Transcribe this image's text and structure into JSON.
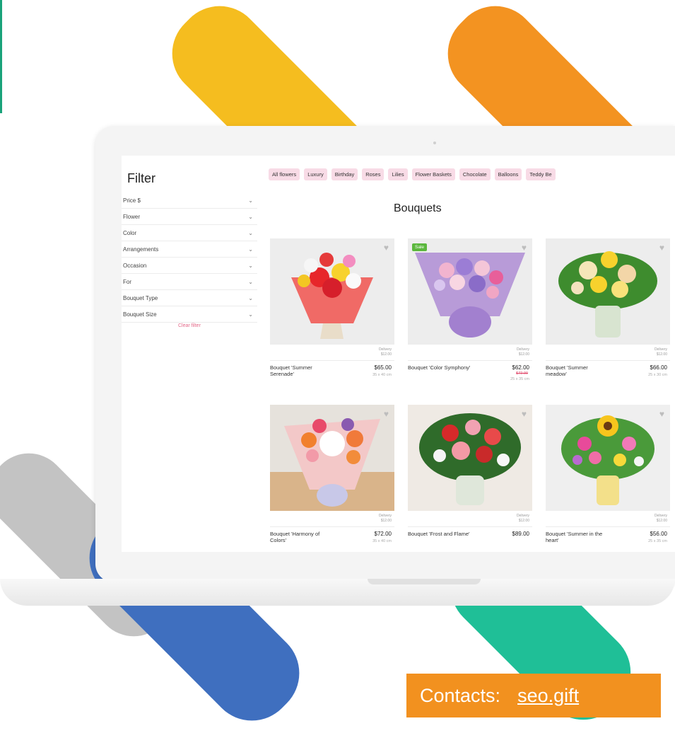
{
  "sidebar": {
    "title": "Filter",
    "filters": [
      "Price $",
      "Flower",
      "Color",
      "Arrangements",
      "Occasion",
      "For",
      "Bouquet Type",
      "Bouquet Size"
    ],
    "clear_label": "Clear filter"
  },
  "tags": [
    "All flowers",
    "Luxury",
    "Birthday",
    "Roses",
    "Lilies",
    "Flower Baskets",
    "Chocolate",
    "Balloons",
    "Teddy Be"
  ],
  "heading": "Bouquets",
  "products": [
    {
      "name": "Bouquet 'Summer Serenade'",
      "price": "$65.00",
      "old_price": "",
      "size": "35 x 40 cm",
      "badge": "",
      "delivery": "Delivery",
      "delivery_price": "$12.00"
    },
    {
      "name": "Bouquet 'Color Symphony'",
      "price": "$62.00",
      "old_price": "$72.00",
      "size": "25 x 35 cm",
      "badge": "Sale",
      "delivery": "Delivery",
      "delivery_price": "$12.00"
    },
    {
      "name": "Bouquet 'Summer meadow'",
      "price": "$66.00",
      "old_price": "",
      "size": "25 x 30 cm",
      "badge": "",
      "delivery": "Delivery",
      "delivery_price": "$12.00"
    },
    {
      "name": "Bouquet 'Harmony of Colors'",
      "price": "$72.00",
      "old_price": "",
      "size": "35 x 40 cm",
      "badge": "",
      "delivery": "Delivery",
      "delivery_price": "$12.00"
    },
    {
      "name": "Bouquet 'Frost and Flame'",
      "price": "$89.00",
      "old_price": "",
      "size": "",
      "badge": "",
      "delivery": "Delivery",
      "delivery_price": "$12.00"
    },
    {
      "name": "Bouquet 'Summer in the heart'",
      "price": "$56.00",
      "old_price": "",
      "size": "25 x 35 cm",
      "badge": "",
      "delivery": "Delivery",
      "delivery_price": "$12.00"
    }
  ],
  "contact": {
    "label": "Contacts:",
    "link": "seo.gift"
  },
  "colors": {
    "yellow": "#f5bd1f",
    "orange": "#f39321",
    "blue": "#3f6fbf",
    "teal": "#1fbf97",
    "gray": "#c3c3c3",
    "tag_bg": "#f8dbe6",
    "sale": "#5bb73d"
  }
}
